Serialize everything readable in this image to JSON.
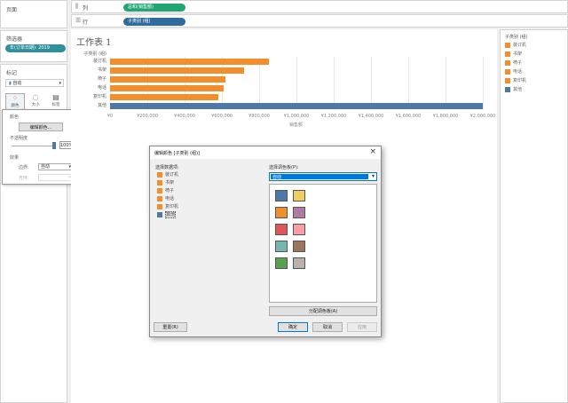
{
  "left": {
    "pages_title": "页面",
    "filters_title": "筛选器",
    "filter_pill": "年(订单日期): 2019",
    "marks_title": "标记",
    "marks_type": "自动",
    "marks_buttons": [
      {
        "label": "颜色",
        "icon": "dots-color-icon"
      },
      {
        "label": "大小",
        "icon": "size-icon"
      },
      {
        "label": "标签",
        "icon": "label-icon"
      }
    ],
    "color_popup": {
      "section_color": "颜色",
      "edit_colors_btn": "编辑颜色...",
      "opacity_label": "不透明度",
      "opacity_value": "100%",
      "effects_label": "效果",
      "border_label": "边界:",
      "border_value": "自动",
      "halo_label": "光环:"
    }
  },
  "shelves": {
    "columns_label": "列",
    "columns_pill": "总和(销售额)",
    "rows_label": "行",
    "rows_pill": "子类别 (组)"
  },
  "sheet": {
    "title": "工作表 1",
    "colors": {
      "orange": "#f28e2b",
      "blue": "#4e79a7"
    }
  },
  "chart_data": {
    "type": "bar",
    "orientation": "horizontal",
    "y_header": "子类别 (组)",
    "categories": [
      "装订机",
      "书架",
      "椅子",
      "电话",
      "复印机",
      "其他"
    ],
    "values": [
      850000,
      720000,
      620000,
      610000,
      580000,
      2000000
    ],
    "bar_colors": [
      "#f28e2b",
      "#f28e2b",
      "#f28e2b",
      "#f28e2b",
      "#f28e2b",
      "#4e79a7"
    ],
    "xlabel": "销售额",
    "xlim": [
      0,
      2000000
    ],
    "ticks": [
      "¥0",
      "¥200,000",
      "¥400,000",
      "¥600,000",
      "¥800,000",
      "¥1,000,000",
      "¥1,200,000",
      "¥1,400,000",
      "¥1,600,000",
      "¥1,800,000",
      "¥2,000,000"
    ],
    "tick_values": [
      0,
      200000,
      400000,
      600000,
      800000,
      1000000,
      1200000,
      1400000,
      1600000,
      1800000,
      2000000
    ]
  },
  "legend": {
    "title": "子类别 (组)",
    "items": [
      {
        "label": "装订机",
        "color": "#f28e2b"
      },
      {
        "label": "书架",
        "color": "#f28e2b"
      },
      {
        "label": "椅子",
        "color": "#f28e2b"
      },
      {
        "label": "电话",
        "color": "#f28e2b"
      },
      {
        "label": "复印机",
        "color": "#f28e2b"
      },
      {
        "label": "其他",
        "color": "#4e79a7"
      }
    ]
  },
  "dialog": {
    "title": "编辑颜色 [子类别 (组)]",
    "select_item_label": "选择数据项:",
    "select_palette_label": "选择调色板(P):",
    "palette_value": "自动",
    "items": [
      {
        "label": "装订机",
        "color": "#f28e2b"
      },
      {
        "label": "书架",
        "color": "#f28e2b"
      },
      {
        "label": "椅子",
        "color": "#f28e2b"
      },
      {
        "label": "电话",
        "color": "#f28e2b"
      },
      {
        "label": "复印机",
        "color": "#f28e2b"
      },
      {
        "label": "其他",
        "color": "#4e79a7"
      }
    ],
    "palette_colors": [
      "#4e79a7",
      "#f1ce63",
      "#f28e2b",
      "#b07aa1",
      "#e15759",
      "#ff9da7",
      "#76b7b2",
      "#9c755f",
      "#59a14f",
      "#bab0ac"
    ],
    "assign_palette_btn": "分配调色板(A)",
    "reset_btn": "重置(R)",
    "ok_btn": "确定",
    "cancel_btn": "取消",
    "apply_btn": "应用"
  }
}
